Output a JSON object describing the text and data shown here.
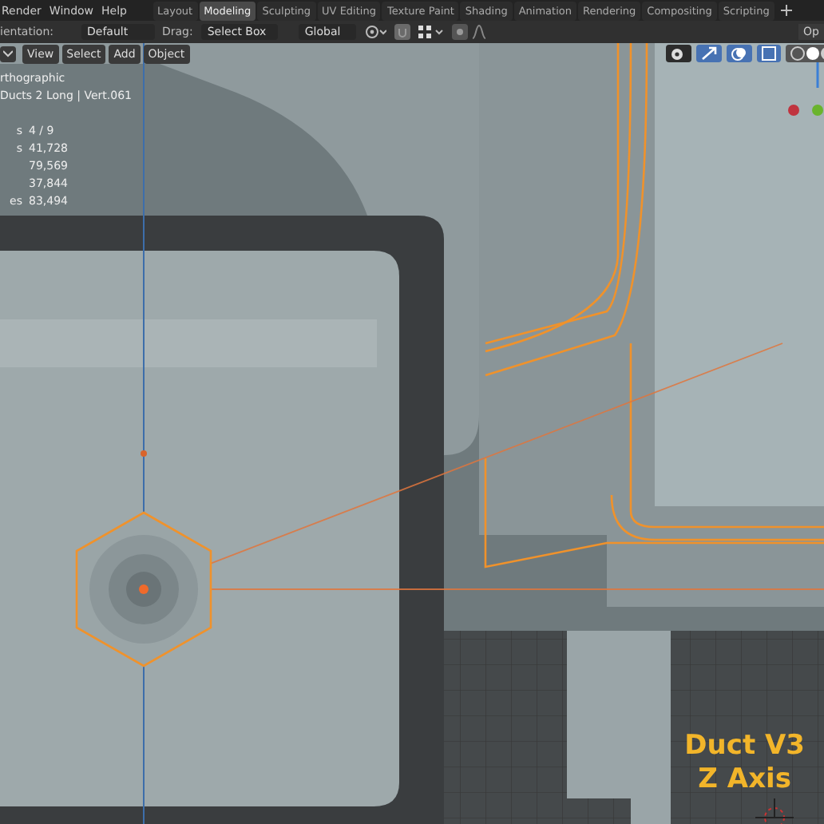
{
  "menus": [
    "Render",
    "Window",
    "Help"
  ],
  "workspace_tabs": [
    {
      "label": "Layout",
      "selected": false
    },
    {
      "label": "Modeling",
      "selected": true
    },
    {
      "label": "Sculpting",
      "selected": false
    },
    {
      "label": "UV Editing",
      "selected": false
    },
    {
      "label": "Texture Paint",
      "selected": false
    },
    {
      "label": "Shading",
      "selected": false
    },
    {
      "label": "Animation",
      "selected": false
    },
    {
      "label": "Rendering",
      "selected": false
    },
    {
      "label": "Compositing",
      "selected": false
    },
    {
      "label": "Scripting",
      "selected": false
    }
  ],
  "tool_header": {
    "orientation_label": "ientation:",
    "orientation_value": "Default",
    "drag_label": "Drag:",
    "drag_value": "Select Box",
    "transform_value": "Global",
    "options_label": "Op"
  },
  "viewport_header": {
    "menus": [
      "View",
      "Select",
      "Add",
      "Object"
    ]
  },
  "overlay": {
    "view_name": "rthographic",
    "object_info": "Ducts 2 Long | Vert.061",
    "stats": [
      {
        "label": "s",
        "value": "4 / 9"
      },
      {
        "label": "s",
        "value": "41,728"
      },
      {
        "value": "79,569"
      },
      {
        "value": "37,844"
      },
      {
        "label": "es",
        "value": "83,494"
      }
    ]
  },
  "caption": [
    "Duct V3",
    "Z Axis"
  ]
}
